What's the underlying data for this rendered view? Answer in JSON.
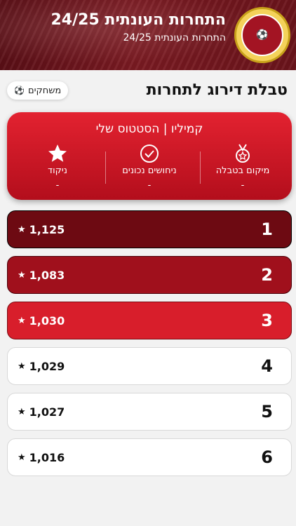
{
  "header": {
    "title": "התחרות העונתית 24/25",
    "subtitle": "התחרות העונתית 24/25"
  },
  "page": {
    "title": "טבלת דירוג לתחרות",
    "games_button": "משחקים"
  },
  "status": {
    "title": "קמיליו | הסטטוס שלי",
    "rank_label": "מיקום בטבלה",
    "rank_value": "-",
    "correct_label": "ניחושים נכונים",
    "correct_value": "-",
    "points_label": "ניקוד",
    "points_value": "-"
  },
  "leaderboard": [
    {
      "rank": "1",
      "score": "1,125"
    },
    {
      "rank": "2",
      "score": "1,083"
    },
    {
      "rank": "3",
      "score": "1,030"
    },
    {
      "rank": "4",
      "score": "1,029"
    },
    {
      "rank": "5",
      "score": "1,027"
    },
    {
      "rank": "6",
      "score": "1,016"
    }
  ],
  "colors": {
    "accent": "#d81e2b",
    "first_place": "#6d0a12",
    "second_place": "#a0101c",
    "third_place": "#d81e2b"
  }
}
